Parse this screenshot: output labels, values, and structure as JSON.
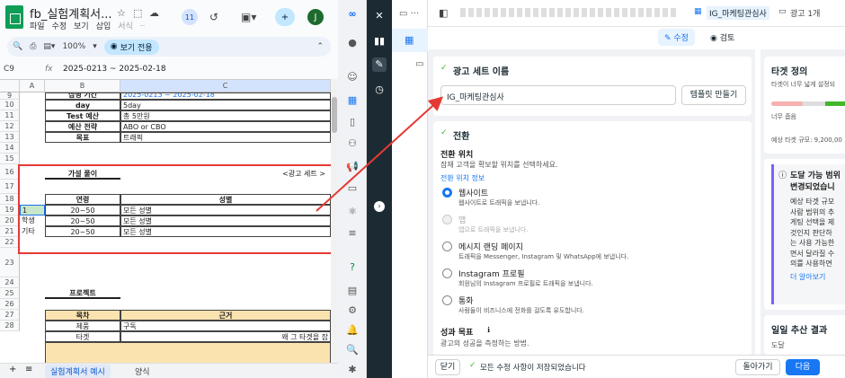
{
  "sheets": {
    "title": "fb_실험계획서...",
    "menu": [
      "파일",
      "수정",
      "보기",
      "삽입",
      "서식",
      ".."
    ],
    "badge": "11",
    "avatar": "J",
    "zoom": "100%",
    "view_only": "보기 전용",
    "namebox": "C9",
    "fx": "fx",
    "formula": "2025-0213 ~ 2025-02-18",
    "columns": [
      "A",
      "B",
      "C"
    ],
    "rows": [
      "9",
      "10",
      "11",
      "12",
      "13",
      "14",
      "15",
      "16",
      "17",
      "18",
      "19",
      "20",
      "21",
      "22",
      "23",
      "24",
      "25",
      "26",
      "27",
      "28"
    ],
    "r9": {
      "b": "집행 기간",
      "c": "2025-0213 ~ 2025-02-18"
    },
    "r10": {
      "b": "day",
      "c": "5day"
    },
    "r11": {
      "b": "Test 예산",
      "c": "총 5만원"
    },
    "r12": {
      "b": "예산 전략",
      "c": "ABO or CBO"
    },
    "r13": {
      "b": "목표",
      "c": "트래픽"
    },
    "r16": {
      "b": "가설 풀이",
      "c": "<광고 세트 >"
    },
    "r18": {
      "b": "연령",
      "c": "성별"
    },
    "r19": {
      "a": "1",
      "b": "20~50",
      "c": "모든 성별"
    },
    "r20": {
      "a": "학생",
      "b": "20~50",
      "c": "모든 성별"
    },
    "r21": {
      "a": "기타",
      "b": "20~50",
      "c": "모든 성별"
    },
    "r24": {
      "b": "프로젝트"
    },
    "r26": {
      "b": "목차",
      "c": "근거"
    },
    "r27": {
      "b": "제품",
      "c": "구독"
    },
    "r28": {
      "b": "타겟",
      "c": "왜 그 타겟을 잡"
    },
    "tabs": [
      "실험계획서 예시",
      "양식"
    ]
  },
  "meta": {
    "breadcrumb_campaign": "IG_마케팅관심사",
    "breadcrumb_adset": "광고 1개",
    "edit_label": "수정",
    "review_label": "검토",
    "adset_name_heading": "광고 세트 이름",
    "adset_name_value": "IG_마케팅관심사",
    "template_button": "템플릿 만들기",
    "conversion_heading": "전환",
    "conversion_location": "전환 위치",
    "conversion_location_desc": "잠재 고객을 확보할 위치를 선택하세요.",
    "conversion_info_link": "전환 위치 정보",
    "options": [
      {
        "label": "웹사이트",
        "desc": "웹사이트로 트래픽을 보냅니다.",
        "state": "selected"
      },
      {
        "label": "앱",
        "desc": "앱으로 트래픽을 보냅니다.",
        "state": "disabled"
      },
      {
        "label": "메시지 랜딩 페이지",
        "desc": "트래픽을 Messenger, Instagram 및 WhatsApp에 보냅니다.",
        "state": "off"
      },
      {
        "label": "Instagram 프로필",
        "desc": "회원님의 Instagram 프로필로 트래픽을 보냅니다.",
        "state": "off"
      },
      {
        "label": "통화",
        "desc": "사람들이 비즈니스에 전화를 걸도록 유도합니다.",
        "state": "off"
      }
    ],
    "performance_goal": "성과 목표",
    "performance_goal_desc": "광고의 성공을 측정하는 방법.",
    "target_heading": "타겟 정의",
    "target_desc": "타겟이 너무 넓게 설정되",
    "target_narrow": "너무 좁음",
    "target_size": "예상 타겟 규모: 9,200,00",
    "notice_title_1": "도달 가능 범위",
    "notice_title_2": "변경되었습니",
    "notice_body": [
      "예상 타겟 규모",
      "사람 범위의 추",
      "게팅 선택을 제",
      "것인지 판단하",
      "는 사용 가능한",
      "면서 달라질 수",
      "의를 사용하면"
    ],
    "learn_more": "더 알아보기",
    "daily_results": "일일 추산 결과",
    "reach": "도달",
    "close_button": "닫기",
    "saved_status": "모든 수정 사항이 저장되었습니다",
    "back_button": "돌아가기",
    "next_button": "다음"
  },
  "colors": {
    "sheets_green": "#0f9d58",
    "meta_blue": "#1877f2",
    "highlight_red": "#e53935",
    "dark_nav": "#1c2b33"
  }
}
